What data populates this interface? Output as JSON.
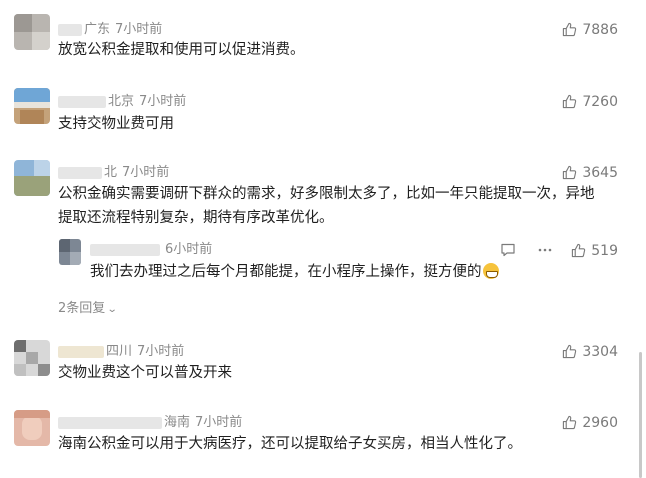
{
  "comments": [
    {
      "location": "广东",
      "time": "7小时前",
      "text": "放宽公积金提取和使用可以促进消费。",
      "likes": "7886"
    },
    {
      "location": "北京",
      "time": "7小时前",
      "text": "支持交物业费可用",
      "likes": "7260"
    },
    {
      "location": "北",
      "time": "7小时前",
      "text_line1": "公积金确实需要调研下群众的需求，好多限制太多了，比如一年只能提取一次，异地",
      "text_line2": "提取还流程特别复杂，期待有序改革优化。",
      "likes": "3645",
      "reply": {
        "time": "6小时前",
        "text": "我们去办理过之后每个月都能提，在小程序上操作，挺方便的",
        "likes": "519"
      },
      "replies_toggle": "2条回复"
    },
    {
      "location": "四川",
      "time": "7小时前",
      "text": "交物业费这个可以普及开来",
      "likes": "3304"
    },
    {
      "location": "海南",
      "time": "7小时前",
      "text": "海南公积金可以用于大病医疗，还可以提取给子女买房，相当人性化了。",
      "likes": "2960"
    }
  ],
  "icons": {
    "like": "thumbs-up-icon",
    "comment": "comment-icon",
    "more": "more-dots-icon",
    "emoji": "grinning-emoji-icon"
  }
}
